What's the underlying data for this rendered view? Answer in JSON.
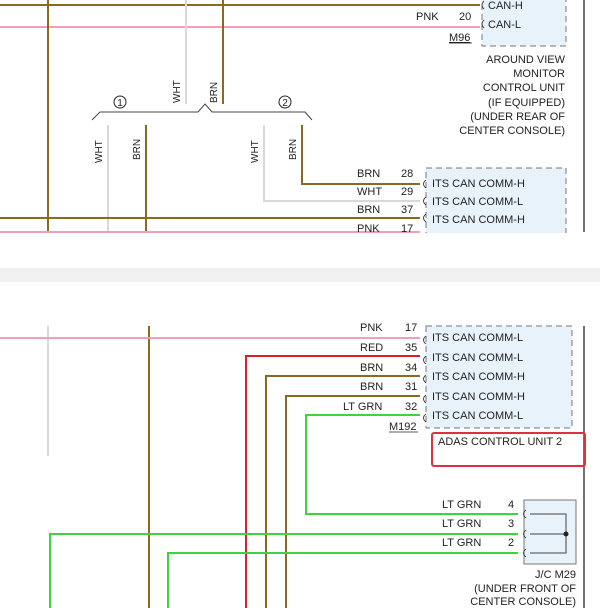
{
  "wire_colors": {
    "BRN": "#8a6a1f",
    "WHT": "#d8d8d8",
    "PNK": "#f0a0b4",
    "RED": "#d8202a",
    "LT GRN": "#3ed43e"
  },
  "top_panel": {
    "conn_label_top": "CAN-H",
    "pnk_wire_label": "PNK",
    "pin_20": "20",
    "can_l": "CAN-L",
    "connector_m96": "M96",
    "avm_unit": [
      "AROUND VIEW",
      "MONITOR",
      "CONTROL UNIT",
      "(IF EQUIPPED)",
      "(UNDER REAR OF",
      "CENTER CONSOLE)"
    ],
    "vertical_labels": {
      "wht_top": "WHT",
      "brn_top": "BRN",
      "wht_1": "WHT",
      "brn_1": "BRN",
      "wht_2": "WHT",
      "brn_2": "BRN"
    },
    "branch_1": "1",
    "branch_2": "2",
    "rows": [
      {
        "wire": "BRN",
        "pin": "28",
        "signal": "ITS CAN COMM-H"
      },
      {
        "wire": "WHT",
        "pin": "29",
        "signal": "ITS CAN COMM-L"
      },
      {
        "wire": "BRN",
        "pin": "37",
        "signal": "ITS CAN COMM-H"
      },
      {
        "wire": "PNK",
        "pin": "17",
        "signal": ""
      }
    ]
  },
  "bottom_panel": {
    "rows": [
      {
        "wire": "PNK",
        "pin": "17",
        "signal": "ITS CAN COMM-L"
      },
      {
        "wire": "RED",
        "pin": "35",
        "signal": "ITS CAN COMM-L"
      },
      {
        "wire": "BRN",
        "pin": "34",
        "signal": "ITS CAN COMM-H"
      },
      {
        "wire": "BRN",
        "pin": "31",
        "signal": "ITS CAN COMM-H"
      },
      {
        "wire": "LT GRN",
        "pin": "32",
        "signal": "ITS CAN COMM-L"
      }
    ],
    "connector_m192": "M192",
    "adas_unit": "ADAS CONTROL UNIT 2",
    "jc_rows": [
      {
        "wire": "LT GRN",
        "pin": "4"
      },
      {
        "wire": "LT GRN",
        "pin": "3"
      },
      {
        "wire": "LT GRN",
        "pin": "2"
      }
    ],
    "jc_label": [
      "J/C M29",
      "(UNDER FRONT OF",
      "CENTER CONSOLE)"
    ]
  }
}
